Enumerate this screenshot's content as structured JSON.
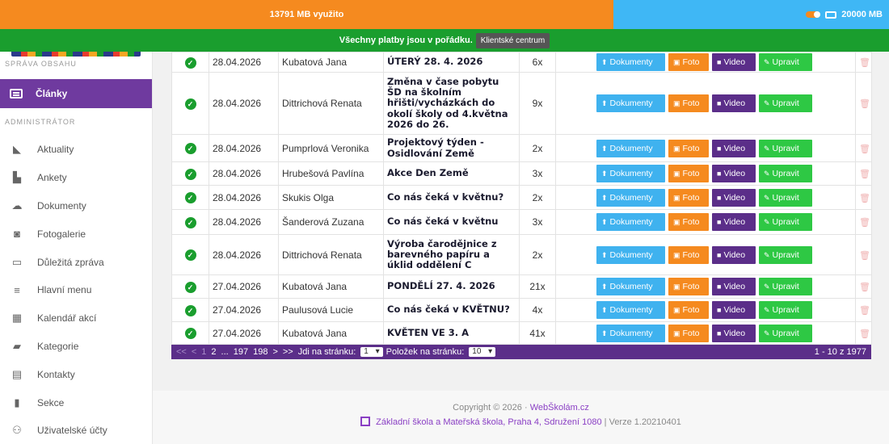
{
  "storage": {
    "used_label": "13791 MB využito",
    "total_label": "20000 MB",
    "used_fraction": 0.6896
  },
  "status": {
    "message": "Všechny platby jsou v pořádku.",
    "tooltip": "Klientské centrum"
  },
  "sidebar": {
    "section_top": "SPRÁVA OBSAHU",
    "active_item": "Články",
    "section_admin": "ADMINISTRÁTOR",
    "items": [
      {
        "label": "Aktuality",
        "icon": "bullhorn-icon"
      },
      {
        "label": "Ankety",
        "icon": "bar-chart-icon"
      },
      {
        "label": "Dokumenty",
        "icon": "cloud-upload-icon"
      },
      {
        "label": "Fotogalerie",
        "icon": "camera-icon"
      },
      {
        "label": "Důležitá zpráva",
        "icon": "window-icon"
      },
      {
        "label": "Hlavní menu",
        "icon": "hamburger-icon"
      },
      {
        "label": "Kalendář akcí",
        "icon": "calendar-icon"
      },
      {
        "label": "Kategorie",
        "icon": "folder-icon"
      },
      {
        "label": "Kontakty",
        "icon": "contact-card-icon"
      },
      {
        "label": "Sekce",
        "icon": "file-icon"
      },
      {
        "label": "Uživatelské účty",
        "icon": "users-icon"
      }
    ]
  },
  "buttons": {
    "documents": "Dokumenty",
    "photo": "Foto",
    "video": "Video",
    "edit": "Upravit"
  },
  "rows": [
    {
      "date": "28.04.2026",
      "author": "Kubatová Jana",
      "title": "ÚTERÝ 28. 4. 2026",
      "views": "6x"
    },
    {
      "date": "28.04.2026",
      "author": "Dittrichová Renata",
      "title": "Změna v čase pobytu ŠD na školním hřišti/vycházkách do okolí školy od 4.května 2026 do 26.",
      "views": "9x"
    },
    {
      "date": "28.04.2026",
      "author": "Pumprlová Veronika",
      "title": "Projektový týden - Osidlování Země",
      "views": "2x"
    },
    {
      "date": "28.04.2026",
      "author": "Hrubešová Pavlína",
      "title": "Akce Den Země",
      "views": "3x"
    },
    {
      "date": "28.04.2026",
      "author": "Skukis Olga",
      "title": "Co nás čeká v květnu?",
      "views": "2x"
    },
    {
      "date": "28.04.2026",
      "author": "Šanderová Zuzana",
      "title": "Co nás čeká v květnu",
      "views": "3x"
    },
    {
      "date": "28.04.2026",
      "author": "Dittrichová Renata",
      "title": "Výroba čarodějnice z barevného papíru a úklid oddělení C",
      "views": "2x"
    },
    {
      "date": "27.04.2026",
      "author": "Kubatová Jana",
      "title": "PONDĚLÍ 27. 4. 2026",
      "views": "21x"
    },
    {
      "date": "27.04.2026",
      "author": "Paulusová Lucie",
      "title": "Co nás čeká v KVĚTNU?",
      "views": "4x"
    },
    {
      "date": "27.04.2026",
      "author": "Kubatová Jana",
      "title": "KVĚTEN VE 3. A",
      "views": "41x"
    }
  ],
  "pager": {
    "first": "<<",
    "prev": "<",
    "p1": "1",
    "p2": "2",
    "ellipsis": "...",
    "p197": "197",
    "p198": "198",
    "next": ">",
    "last": ">>",
    "goto_label": "Jdi na stránku:",
    "goto_value": "1",
    "per_page_label": "Položek na stránku:",
    "per_page_value": "10",
    "range": "1 - 10 z 1977"
  },
  "footer": {
    "copyright": "Copyright © 2026",
    "sep": "·",
    "brand": "WebŠkolám.cz",
    "school": "Základní škola a Mateřská škola, Praha 4, Sdružení 1080",
    "version": "| Verze 1.20210401"
  }
}
